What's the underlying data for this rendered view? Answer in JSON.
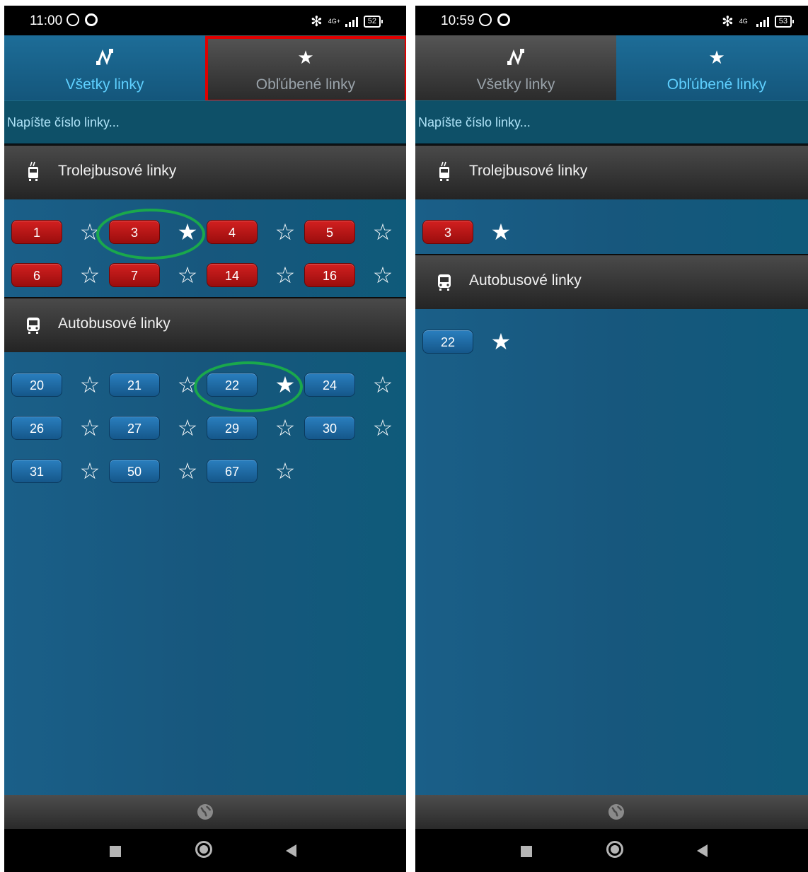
{
  "left": {
    "status": {
      "time": "11:00",
      "network": "4G+",
      "battery": "52"
    },
    "tabs": {
      "all": "Všetky linky",
      "favorites": "Obľúbené linky",
      "active": "all"
    },
    "search_placeholder": "Napíšte číslo linky...",
    "sections": {
      "trolleybus": {
        "title": "Trolejbusové linky",
        "lines": [
          {
            "num": "1",
            "fav": false
          },
          {
            "num": "3",
            "fav": true
          },
          {
            "num": "4",
            "fav": false
          },
          {
            "num": "5",
            "fav": false
          },
          {
            "num": "6",
            "fav": false
          },
          {
            "num": "7",
            "fav": false
          },
          {
            "num": "14",
            "fav": false
          },
          {
            "num": "16",
            "fav": false
          }
        ]
      },
      "bus": {
        "title": "Autobusové linky",
        "lines": [
          {
            "num": "20",
            "fav": false
          },
          {
            "num": "21",
            "fav": false
          },
          {
            "num": "22",
            "fav": true
          },
          {
            "num": "24",
            "fav": false
          },
          {
            "num": "26",
            "fav": false
          },
          {
            "num": "27",
            "fav": false
          },
          {
            "num": "29",
            "fav": false
          },
          {
            "num": "30",
            "fav": false
          },
          {
            "num": "31",
            "fav": false
          },
          {
            "num": "50",
            "fav": false
          },
          {
            "num": "67",
            "fav": false
          }
        ]
      }
    }
  },
  "right": {
    "status": {
      "time": "10:59",
      "network": "4G",
      "battery": "53"
    },
    "tabs": {
      "all": "Všetky linky",
      "favorites": "Obľúbené linky",
      "active": "favorites"
    },
    "search_placeholder": "Napíšte číslo linky...",
    "sections": {
      "trolleybus": {
        "title": "Trolejbusové linky",
        "lines": [
          {
            "num": "3",
            "fav": true
          }
        ]
      },
      "bus": {
        "title": "Autobusové linky",
        "lines": [
          {
            "num": "22",
            "fav": true
          }
        ]
      }
    }
  },
  "icons": {
    "tab_all": "route-icon",
    "tab_favorites": "star-icon",
    "trolleybus": "trolleybus-icon",
    "bus": "bus-icon",
    "footer": "globe-icon",
    "star_filled": "★",
    "star_empty": "☆"
  },
  "colors": {
    "trolleybus_button": "#b51515",
    "bus_button": "#1f6ea8",
    "active_tab_text": "#5fd0ff",
    "tab_highlight_box": "#e00000",
    "favorite_highlight_ring": "#1aa84c"
  }
}
